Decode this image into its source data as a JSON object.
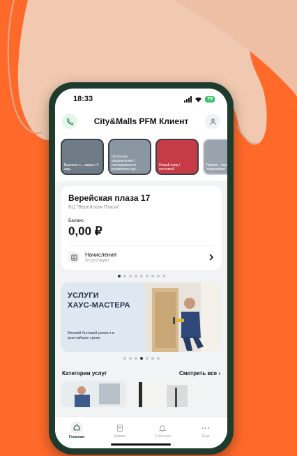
{
  "status_bar": {
    "time": "18:33",
    "battery": "79"
  },
  "app_bar": {
    "title": "City&Malls PFM Клиент",
    "phone_icon": "phone-icon",
    "profile_icon": "user-icon"
  },
  "stories": [
    {
      "text": "Бранная з... закрыт 4 апр..."
    },
    {
      "text": "Об итогах уведомления / неисправности роликового гру..."
    },
    {
      "text": "Новый вход / системой"
    },
    {
      "text": "Прием... передача / территории"
    }
  ],
  "property": {
    "title": "Верейская плаза 17",
    "subtitle": "БЦ \"Верейская Плаза\"",
    "balance_label": "Баланс",
    "balance_value": "0,00 ₽",
    "accrual_title": "Начисления",
    "accrual_status": "Отсутствуют"
  },
  "banner": {
    "title_line1": "УСЛУГИ",
    "title_line2": "ХАУС-МАСТЕРА",
    "subtitle": "Мелкий бытовой ремонт в кратчайшие сроки"
  },
  "categories": {
    "title": "Категории услуг",
    "link": "Смотреть все"
  },
  "tabbar": {
    "items": [
      {
        "label": "Главная",
        "icon": "home-icon"
      },
      {
        "label": "Заявки",
        "icon": "document-icon"
      },
      {
        "label": "События",
        "icon": "bell-icon"
      },
      {
        "label": "Ещё",
        "icon": "more-icon"
      }
    ]
  },
  "colors": {
    "background": "#ff6a2b",
    "phone_frame": "#1f3b2e",
    "accent_green": "#3ac06b"
  }
}
